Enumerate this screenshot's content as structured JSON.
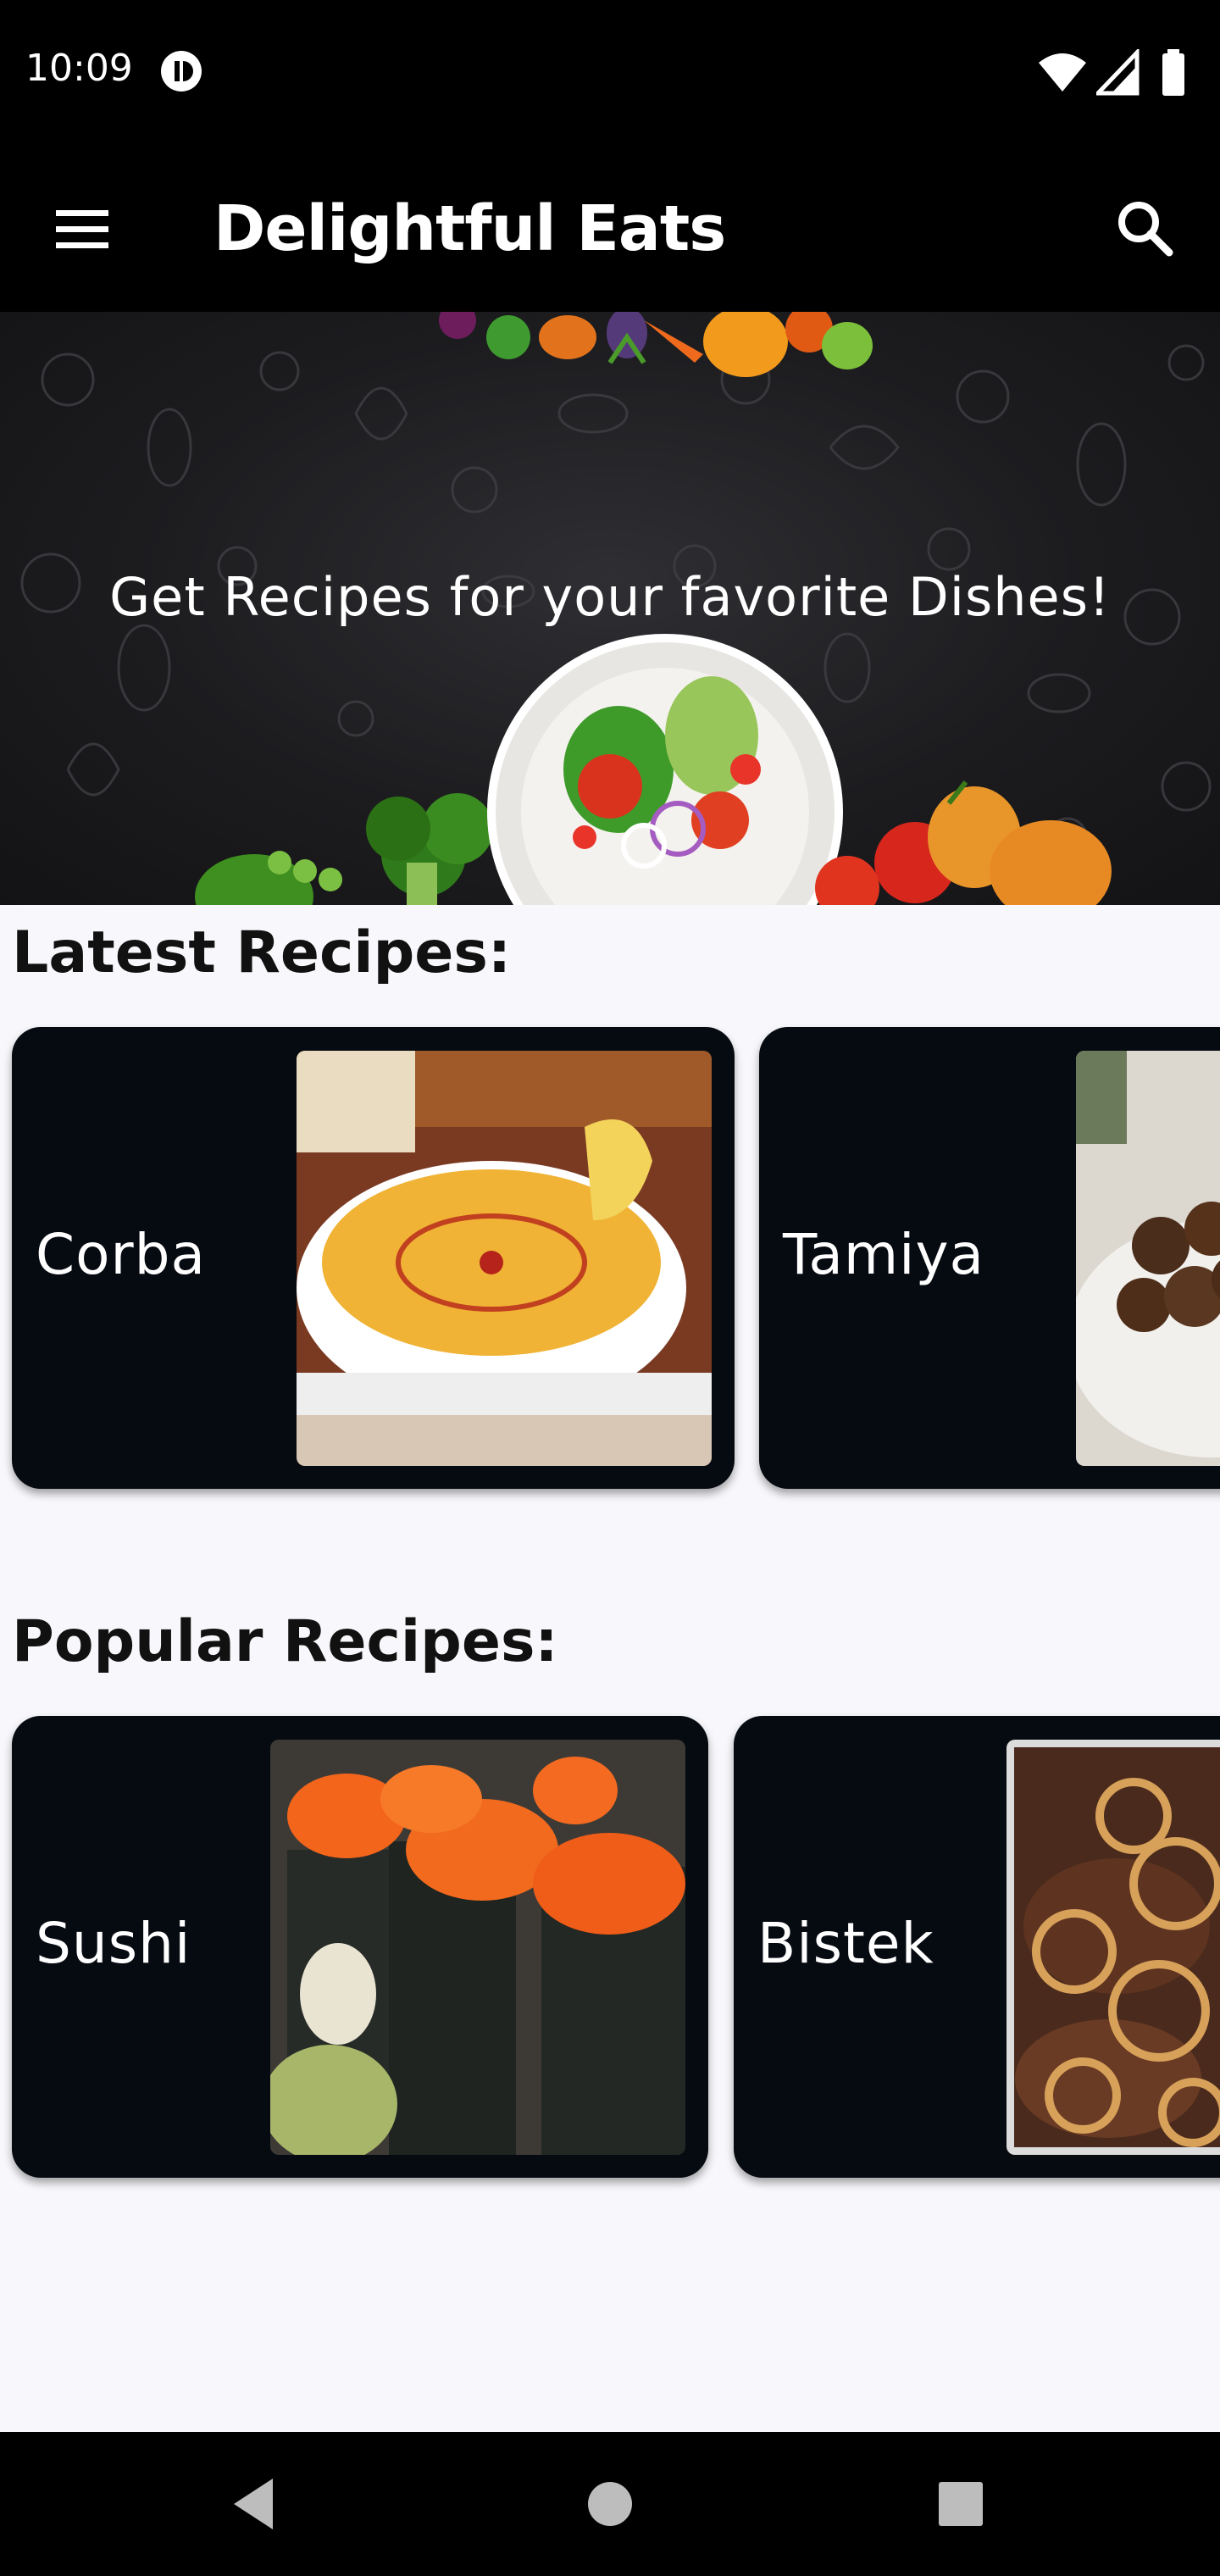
{
  "status_bar": {
    "time": "10:09",
    "icons": [
      "app-notification-icon",
      "wifi-icon",
      "signal-icon",
      "battery-icon"
    ]
  },
  "app_bar": {
    "title": "Delightful Eats",
    "menu_icon": "menu-icon",
    "search_icon": "search-icon"
  },
  "hero": {
    "text": "Get Recipes for your favorite Dishes!"
  },
  "latest": {
    "title": "Latest Recipes:",
    "cards": [
      {
        "label": "Corba",
        "image": "lentil-soup-image"
      },
      {
        "label": "Tamiya",
        "image": "falafel-image"
      }
    ]
  },
  "popular": {
    "title": "Popular Recipes:",
    "cards": [
      {
        "label": "Sushi",
        "image": "sushi-image"
      },
      {
        "label": "Bistek",
        "image": "beef-steak-onions-image"
      }
    ]
  },
  "nav_bar": {
    "icons": [
      "back-icon",
      "home-icon",
      "recents-icon"
    ]
  },
  "colors": {
    "app_bar": "#000000",
    "card_bg": "#060b12",
    "page_bg": "#f8f8fc",
    "soup": "#f0b335",
    "roe": "#f4651c"
  }
}
